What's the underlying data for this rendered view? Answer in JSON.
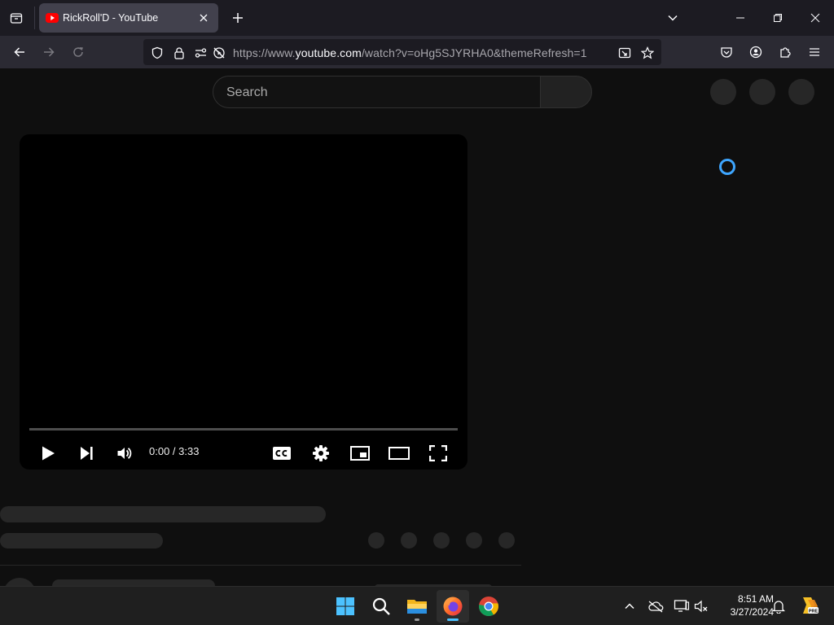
{
  "browser": {
    "tab": {
      "title": "RickRoll'D - YouTube",
      "favicon": "youtube-icon"
    },
    "url": {
      "prefix": "https://www.",
      "host": "youtube.com",
      "path": "/watch?v=oHg5SJYRHA0&themeRefresh=1"
    }
  },
  "youtube": {
    "search_placeholder": "Search",
    "player": {
      "time": "0:00 / 3:33",
      "progress": 0
    }
  },
  "taskbar": {
    "apps": [
      "windows-start-icon",
      "search-icon",
      "file-explorer-icon",
      "firefox-icon",
      "chrome-icon"
    ],
    "clock": {
      "time": "8:51 AM",
      "date": "3/27/2024"
    }
  },
  "colors": {
    "tab_bg": "#42414d",
    "toolbar_bg": "#2b2a33",
    "page_bg": "#0f0f0f",
    "spinner": "#3ea6ff",
    "youtube_red": "#ff0000"
  }
}
